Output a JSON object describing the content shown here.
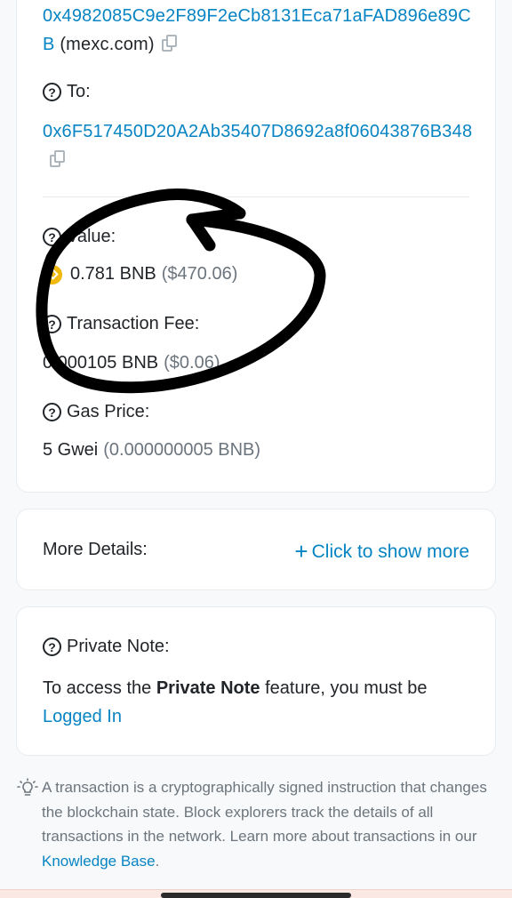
{
  "from": {
    "address": "0x4982085C9e2F89F2eCb8131Eca71aFAD896e89CB",
    "tag": "(mexc.com)",
    "copy_icon": "copy-icon"
  },
  "to": {
    "label": "To:",
    "address": "0x6F517450D20A2Ab35407D8692a8f06043876B348",
    "copy_icon": "copy-icon"
  },
  "value": {
    "label": "Value:",
    "amount": "0.781 BNB",
    "usd": "($470.06)",
    "token_icon": "bnb-icon"
  },
  "fee": {
    "label": "Transaction Fee:",
    "amount": "0.000105 BNB",
    "usd": "($0.06)"
  },
  "gas": {
    "label": "Gas Price:",
    "amount": "5 Gwei",
    "detail": "(0.000000005 BNB)"
  },
  "more_details": {
    "label": "More Details:",
    "link_label": "Click to show more"
  },
  "private_note": {
    "label": "Private Note:",
    "text_before": "To access the ",
    "feature_name": "Private Note",
    "text_after": " feature, you must be ",
    "login_link": "Logged In"
  },
  "footer": {
    "text": "A transaction is a cryptographically signed instruction that changes the blockchain state. Block explorers track the details of all transactions in the network. Learn more about transactions in our ",
    "link": "Knowledge Base",
    "end": "."
  },
  "colors": {
    "link": "#0784c3",
    "text": "#212529",
    "muted": "#6c757d",
    "bnb": "#f0b90b",
    "annotation": "#000000"
  }
}
